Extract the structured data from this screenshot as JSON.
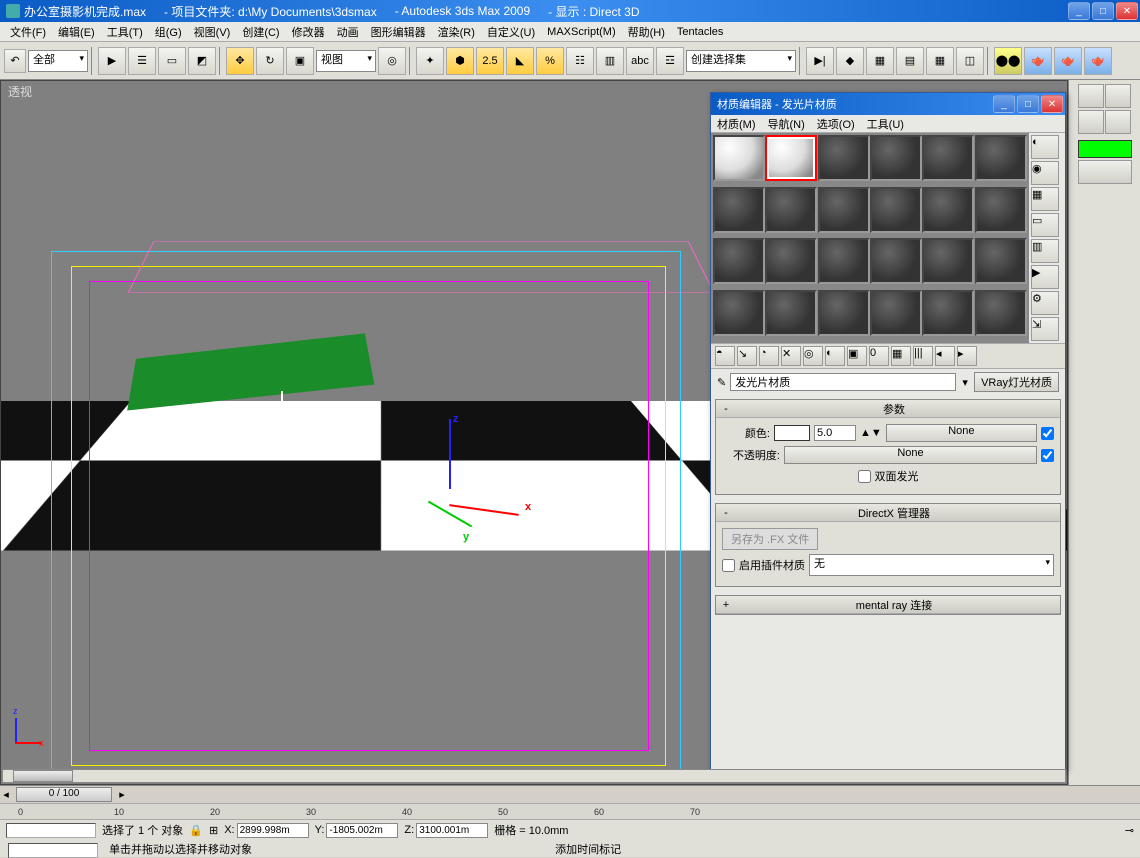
{
  "title": {
    "filename": "办公室摄影机完成.max",
    "project_label": "- 项目文件夹: d:\\My Documents\\3dsmax",
    "app": "- Autodesk 3ds Max  2009",
    "display": "- 显示 : Direct 3D"
  },
  "menu": [
    "文件(F)",
    "编辑(E)",
    "工具(T)",
    "组(G)",
    "视图(V)",
    "创建(C)",
    "修改器",
    "动画",
    "图形编辑器",
    "渲染(R)",
    "自定义(U)",
    "MAXScript(M)",
    "帮助(H)",
    "Tentacles"
  ],
  "toolbar": {
    "filter_dd": "全部",
    "ref_dd": "视图",
    "selset_dd": "创建选择集"
  },
  "viewport": {
    "label": "透视",
    "axes": {
      "x": "x",
      "y": "y",
      "z": "z"
    }
  },
  "mat_editor": {
    "title": "材质编辑器 - 发光片材质",
    "menu": [
      "材质(M)",
      "导航(N)",
      "选项(O)",
      "工具(U)"
    ],
    "name": "发光片材质",
    "type_btn": "VRay灯光材质",
    "rollout_params": "参数",
    "color_lbl": "颜色:",
    "color_val": "5.0",
    "color_map": "None",
    "opacity_lbl": "不透明度:",
    "opacity_map": "None",
    "twoside": "双面发光",
    "rollout_dx": "DirectX 管理器",
    "saveas": "另存为 .FX 文件",
    "enable_plugin": "启用插件材质",
    "plugin_val": "无",
    "rollout_mr": "mental ray 连接"
  },
  "bottom": {
    "frame": "0 / 100",
    "ticks": [
      "0",
      "10",
      "20",
      "30",
      "40",
      "50",
      "60",
      "70"
    ],
    "sel_msg": "选择了 1 个 对象",
    "x": "2899.998m",
    "y": "-1805.002m",
    "z": "3100.001m",
    "grid": "栅格 = 10.0mm",
    "hint": "单击并拖动以选择并移动对象",
    "addtime": "添加时间标记"
  }
}
